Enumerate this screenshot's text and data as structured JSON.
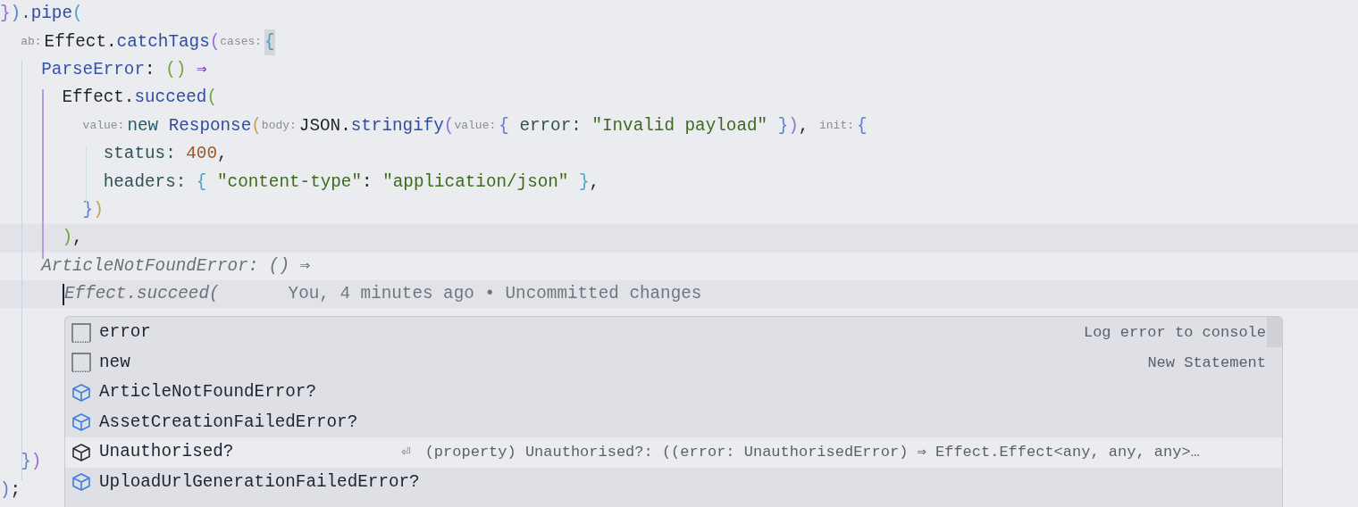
{
  "editor": {
    "lines": [
      {
        "kind": "code",
        "tokens": [
          {
            "text": "}",
            "kind": "b-purple"
          },
          {
            "text": ")",
            "kind": "b-blue"
          },
          {
            "text": ".pipe",
            "kind": "func"
          },
          {
            "text": "(",
            "kind": "b-cyan"
          }
        ]
      },
      {
        "kind": "code",
        "tokens": [
          {
            "text": "  ab:",
            "kind": "hint"
          },
          {
            "text": "Effect.",
            "kind": "plain"
          },
          {
            "text": "catchTags",
            "kind": "func"
          },
          {
            "text": "(",
            "kind": "b-purple"
          },
          {
            "text": "cases:",
            "kind": "hint"
          },
          {
            "text": "{",
            "kind": "b-match"
          }
        ]
      },
      {
        "kind": "code",
        "tokens": [
          {
            "text": "    ParseError",
            "kind": "prop"
          },
          {
            "text": ": ",
            "kind": "plain"
          },
          {
            "text": "()",
            "kind": "b-green"
          },
          {
            "text": " ⇒",
            "kind": "op"
          }
        ]
      },
      {
        "kind": "code",
        "tokens": [
          {
            "text": "      Effect.",
            "kind": "plain"
          },
          {
            "text": "succeed",
            "kind": "func"
          },
          {
            "text": "(",
            "kind": "b-green"
          }
        ]
      },
      {
        "kind": "code",
        "tokens": [
          {
            "text": "        value:",
            "kind": "hint"
          },
          {
            "text": "new",
            "kind": "keyword"
          },
          {
            "text": " Response",
            "kind": "func"
          },
          {
            "text": "(",
            "kind": "b-yellow"
          },
          {
            "text": "body:",
            "kind": "hint"
          },
          {
            "text": "JSON.",
            "kind": "plain"
          },
          {
            "text": "stringify",
            "kind": "func"
          },
          {
            "text": "(",
            "kind": "b-purple"
          },
          {
            "text": "value:",
            "kind": "hint"
          },
          {
            "text": "{",
            "kind": "b-blue"
          },
          {
            "text": " error: ",
            "kind": "field"
          },
          {
            "text": "\"Invalid payload\"",
            "kind": "string"
          },
          {
            "text": " }",
            "kind": "b-blue"
          },
          {
            "text": ")",
            "kind": "b-purple"
          },
          {
            "text": ",",
            "kind": "plain"
          },
          {
            "text": " init:",
            "kind": "hint"
          },
          {
            "text": "{",
            "kind": "b-blue"
          }
        ]
      },
      {
        "kind": "code",
        "tokens": [
          {
            "text": "          status: ",
            "kind": "field"
          },
          {
            "text": "400",
            "kind": "number"
          },
          {
            "text": ",",
            "kind": "plain"
          }
        ]
      },
      {
        "kind": "code",
        "tokens": [
          {
            "text": "          headers: ",
            "kind": "field"
          },
          {
            "text": "{",
            "kind": "b-cyan"
          },
          {
            "text": " \"content-type\"",
            "kind": "string"
          },
          {
            "text": ": ",
            "kind": "plain"
          },
          {
            "text": "\"application/json\"",
            "kind": "string"
          },
          {
            "text": " }",
            "kind": "b-cyan"
          },
          {
            "text": ",",
            "kind": "plain"
          }
        ]
      },
      {
        "kind": "code",
        "tokens": [
          {
            "text": "        }",
            "kind": "b-blue"
          },
          {
            "text": ")",
            "kind": "b-yellow"
          }
        ]
      },
      {
        "kind": "code-highlighted",
        "tokens": [
          {
            "text": "      )",
            "kind": "b-green"
          },
          {
            "text": ",",
            "kind": "plain"
          }
        ]
      },
      {
        "kind": "code",
        "tokens": [
          {
            "text": "    ArticleNotFoundError: () ⇒",
            "kind": "ghost"
          }
        ]
      },
      {
        "kind": "code-highlighted",
        "tokens": [
          {
            "kind": "caret"
          },
          {
            "text": "Effect.succeed(",
            "kind": "ghost"
          },
          {
            "text": "You, 4 minutes ago • Uncommitted changes",
            "kind": "blame"
          }
        ]
      },
      {
        "kind": "blank"
      },
      {
        "kind": "blank"
      },
      {
        "kind": "blank"
      },
      {
        "kind": "blank"
      },
      {
        "kind": "blank"
      },
      {
        "kind": "code",
        "tokens": [
          {
            "text": "  }",
            "kind": "b-blue"
          },
          {
            "text": ")",
            "kind": "b-purple"
          }
        ]
      },
      {
        "kind": "code",
        "tokens": [
          {
            "text": ")",
            "kind": "b-blue"
          },
          {
            "text": ";",
            "kind": "plain"
          }
        ]
      }
    ]
  },
  "completion": {
    "items": [
      {
        "label": "error",
        "kind": "template",
        "selected": false,
        "hint": "Log error to console"
      },
      {
        "label": "new",
        "kind": "template",
        "selected": false,
        "hint": "New Statement"
      },
      {
        "label": "ArticleNotFoundError?",
        "kind": "property",
        "selected": false
      },
      {
        "label": "AssetCreationFailedError?",
        "kind": "property",
        "selected": false
      },
      {
        "label": "Unauthorised?",
        "kind": "property",
        "selected": true,
        "enter_key": "⏎",
        "detail": "(property) Unauthorised?: ((error: UnauthorisedError) ⇒ Effect.Effect<any, any, any>…"
      },
      {
        "label": "UploadUrlGenerationFailedError?",
        "kind": "property",
        "selected": false
      }
    ]
  }
}
